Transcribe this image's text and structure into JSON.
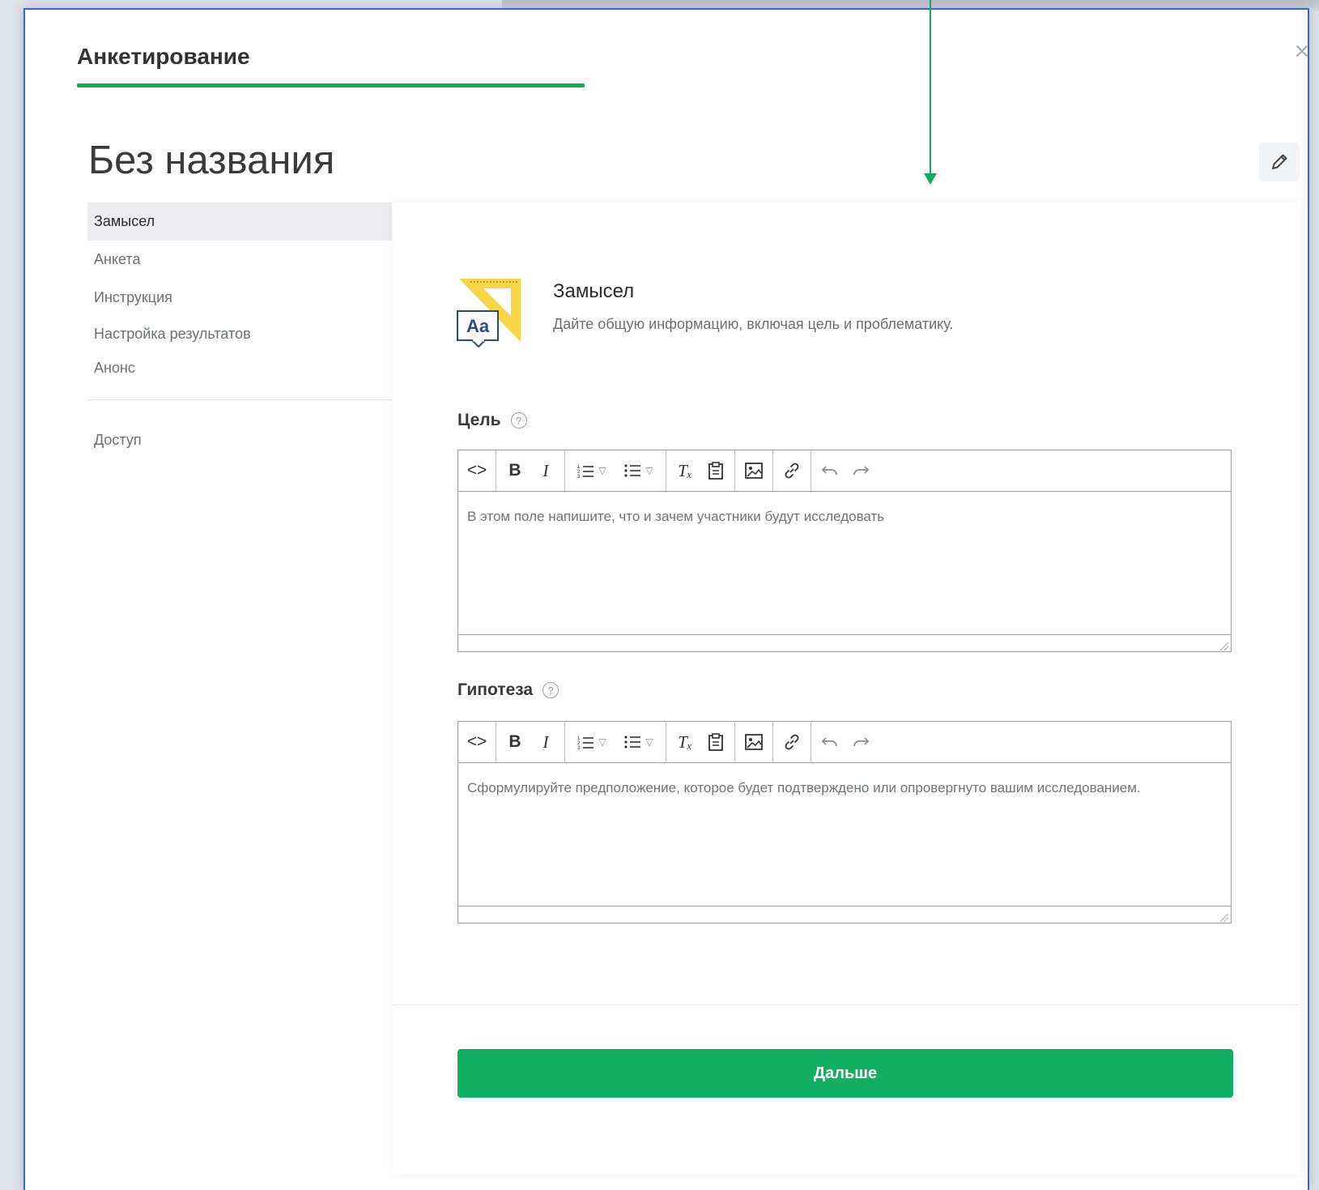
{
  "modal": {
    "title": "Анкетирование",
    "close_label": "×",
    "accent_color": "#16a862",
    "border_color": "#3b66c4"
  },
  "survey": {
    "name": "Без названия"
  },
  "sidebar": {
    "items": [
      {
        "label": "Замысел",
        "active": true
      },
      {
        "label": "Анкета",
        "active": false
      },
      {
        "label": "Инструкция",
        "active": false
      },
      {
        "label": "Настройка результатов",
        "active": false
      },
      {
        "label": "Анонс",
        "active": false
      }
    ],
    "access_label": "Доступ"
  },
  "section": {
    "icon": "ruler-triangle-aa-icon",
    "icon_text": "Aa",
    "title": "Замысел",
    "description": "Дайте общую информацию, включая цель и проблематику."
  },
  "toolbar": {
    "code": "<>",
    "bold": "B",
    "italic": "I",
    "clear_format": "Tₓ"
  },
  "fields": {
    "goal": {
      "label": "Цель",
      "help": "?",
      "placeholder": "В этом поле напишите, что и зачем участники будут исследовать"
    },
    "hypothesis": {
      "label": "Гипотеза",
      "help": "?",
      "placeholder": "Сформулируйте предположение, которое будет подтверждено или опровергнуто вашим исследованием."
    }
  },
  "actions": {
    "next_label": "Дальше",
    "next_color": "#13ae62"
  }
}
